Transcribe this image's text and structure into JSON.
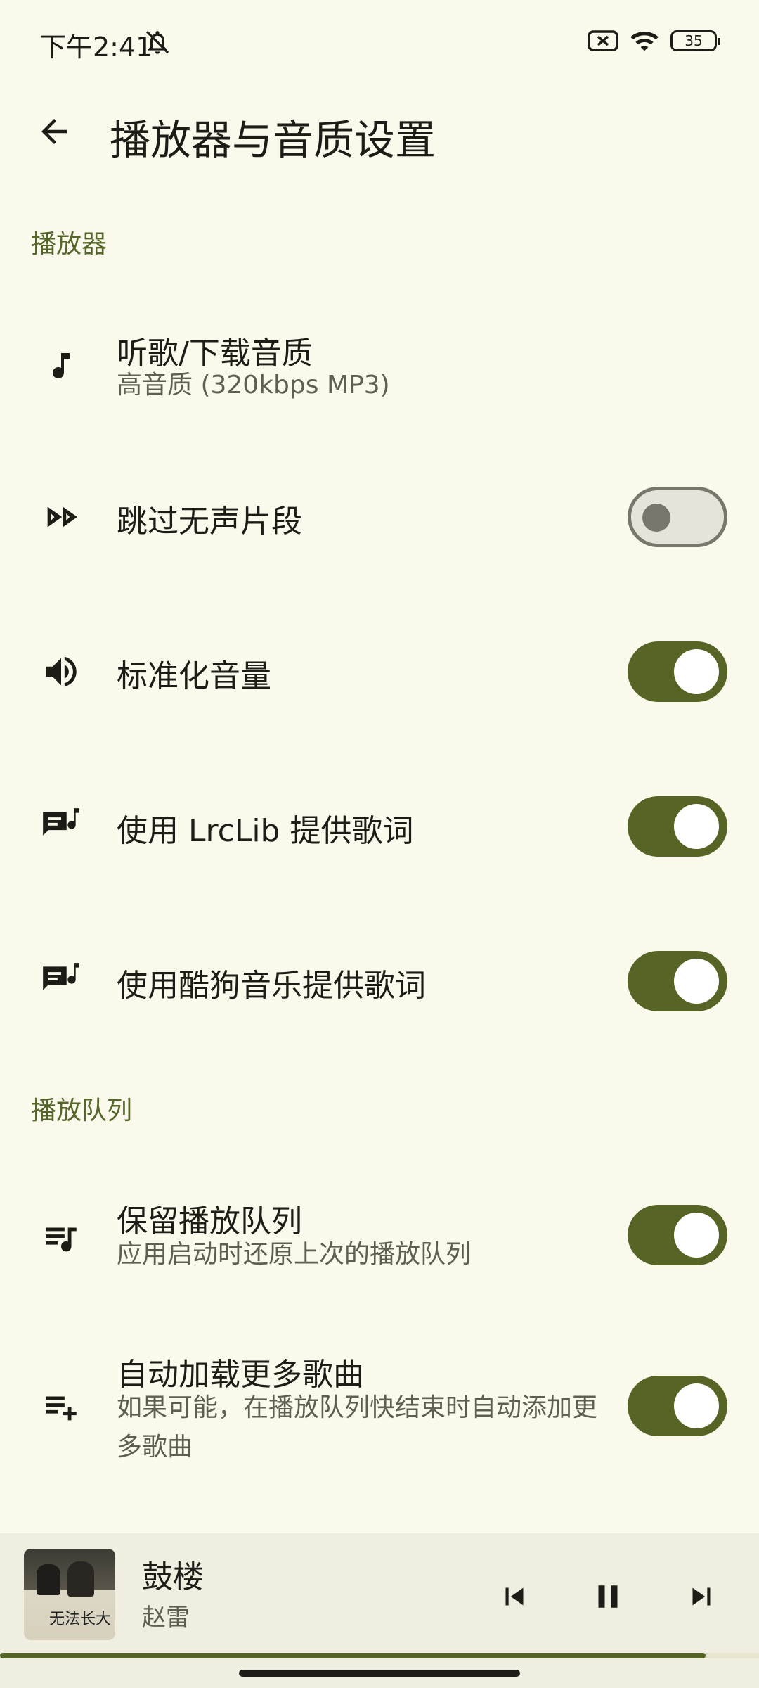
{
  "status_bar": {
    "time": "下午2:41",
    "battery": "35",
    "icons": [
      "bell-off-icon",
      "no-sim-icon",
      "wifi-icon",
      "battery-icon"
    ]
  },
  "app_bar": {
    "title": "播放器与音质设置",
    "back_icon": "arrow-back-icon"
  },
  "sections": {
    "player": {
      "header": "播放器",
      "audio_quality": {
        "title": "听歌/下载音质",
        "subtitle": "高音质 (320kbps MP3)",
        "icon": "music-note-icon"
      },
      "skip_silence": {
        "title": "跳过无声片段",
        "icon": "fast-forward-icon",
        "enabled": false
      },
      "normalize_volume": {
        "title": "标准化音量",
        "icon": "volume-up-icon",
        "enabled": true
      },
      "lrclib_lyrics": {
        "title": "使用 LrcLib 提供歌词",
        "icon": "lyrics-icon",
        "enabled": true
      },
      "kugou_lyrics": {
        "title": "使用酷狗音乐提供歌词",
        "icon": "lyrics-icon",
        "enabled": true
      }
    },
    "queue": {
      "header": "播放队列",
      "persist_queue": {
        "title": "保留播放队列",
        "subtitle": "应用启动时还原上次的播放队列",
        "icon": "queue-music-icon",
        "enabled": true
      },
      "auto_load_more": {
        "title": "自动加载更多歌曲",
        "subtitle": "如果可能，在播放队列快结束时自动添加更多歌曲",
        "icon": "playlist-add-icon",
        "enabled": true
      }
    }
  },
  "mini_player": {
    "title": "鼓楼",
    "artist": "赵雷",
    "album_art_text": "无法长大",
    "progress": 0.93,
    "controls": [
      "skip-previous-icon",
      "pause-icon",
      "skip-next-icon"
    ]
  },
  "colors": {
    "background": "#FBF9EC",
    "accent": "#566526",
    "section_header": "#55662A",
    "text_primary": "#1D1C16",
    "text_secondary": "#5F5E52",
    "player_bg": "#EFEEE1"
  }
}
